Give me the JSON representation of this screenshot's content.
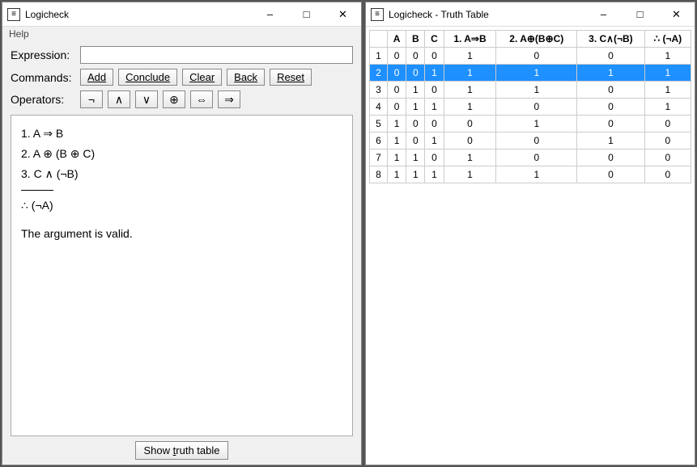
{
  "left": {
    "title": "Logicheck",
    "menu": {
      "help": "Help"
    },
    "labels": {
      "expression": "Expression:",
      "commands": "Commands:",
      "operators": "Operators:"
    },
    "expr_value": "",
    "commands": {
      "add": "Add",
      "conclude": "Conclude",
      "clear": "Clear",
      "back": "Back",
      "reset": "Reset"
    },
    "operators": {
      "not": "¬",
      "and": "∧",
      "or": "∨",
      "xor": "⊕",
      "iff": "⇔",
      "imp": "⇒"
    },
    "premises": [
      "1. A ⇒ B",
      "2. A ⊕ (B ⊕ C)",
      "3. C ∧ (¬B)"
    ],
    "conclusion": "∴ (¬A)",
    "result": "The argument is valid.",
    "show_button_prefix": "Show ",
    "show_button_u": "t",
    "show_button_rest": "ruth table"
  },
  "right": {
    "title": "Logicheck - Truth Table",
    "headers": [
      "",
      "A",
      "B",
      "C",
      "1.  A⇒B",
      "2.  A⊕(B⊕C)",
      "3.  C∧(¬B)",
      "∴  (¬A)"
    ],
    "selected_row": 2,
    "rows": [
      [
        1,
        0,
        0,
        0,
        1,
        0,
        0,
        1
      ],
      [
        2,
        0,
        0,
        1,
        1,
        1,
        1,
        1
      ],
      [
        3,
        0,
        1,
        0,
        1,
        1,
        0,
        1
      ],
      [
        4,
        0,
        1,
        1,
        1,
        0,
        0,
        1
      ],
      [
        5,
        1,
        0,
        0,
        0,
        1,
        0,
        0
      ],
      [
        6,
        1,
        0,
        1,
        0,
        0,
        1,
        0
      ],
      [
        7,
        1,
        1,
        0,
        1,
        0,
        0,
        0
      ],
      [
        8,
        1,
        1,
        1,
        1,
        1,
        0,
        0
      ]
    ]
  }
}
